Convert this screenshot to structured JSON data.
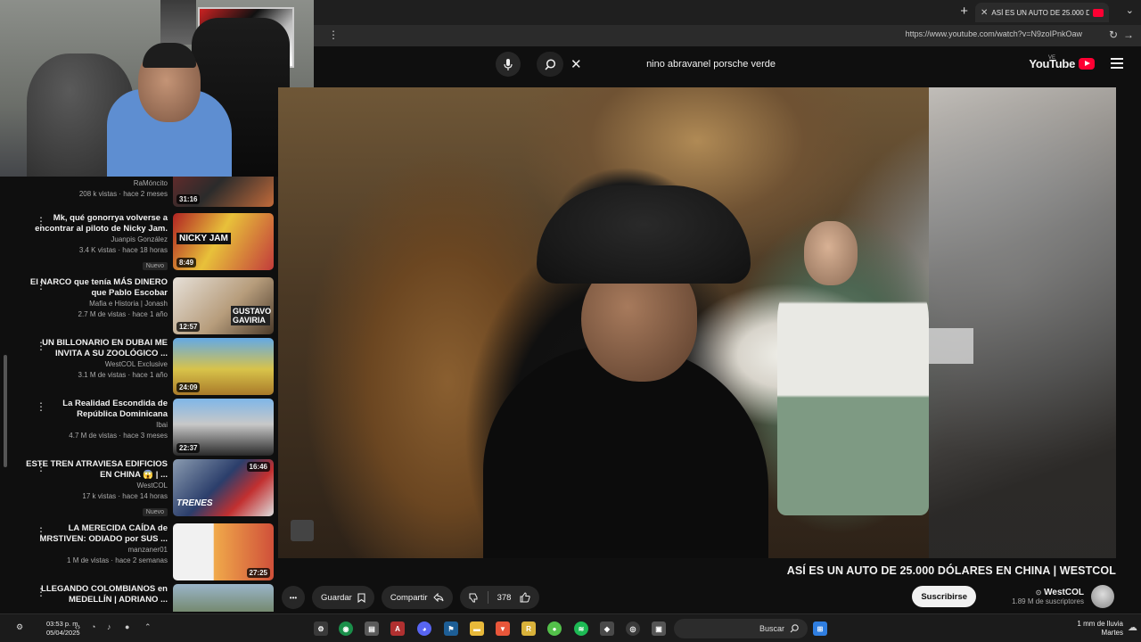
{
  "browser": {
    "tab_title": "ASÍ ES UN AUTO DE 25.000 D",
    "url": "https://www.youtube.com/watch?v=N9zoIPnkOaw",
    "new_tab": "+",
    "tab_close": "✕"
  },
  "youtube": {
    "logo_text": "YouTube",
    "logo_badge": "VE",
    "search_query": "nino abravanel porsche verde",
    "clear_symbol": "✕"
  },
  "video": {
    "title": "ASÍ ES UN AUTO DE 25.000 DÓLARES EN CHINA | WESTCOL",
    "channel_name": "WestCOL",
    "verified": "⊙",
    "subscribers": "1.89 M de suscriptores",
    "subscribe_label": "Suscribirse",
    "likes": "378",
    "share_label": "Compartir",
    "save_label": "Guardar",
    "more_label": "•••"
  },
  "sidebar": {
    "top_partial": {
      "channel": "RaMóncito",
      "views": "208 k vistas · hace 2 meses",
      "duration": "31:16"
    },
    "items": [
      {
        "title": "Mk, qué gonorrya volverse a encontrar al piloto de Nicky Jam.",
        "channel": "Juanpis González",
        "views": "3.4 K vistas · hace 18 horas",
        "badge": "Nuevo",
        "duration": "8:49",
        "thumb_text": "NICKY JAM"
      },
      {
        "title": "El NARCO que tenía MÁS DINERO que Pablo Escobar",
        "channel": "Mafia e Historia | Jonash",
        "views": "2.7 M de vistas · hace 1 año",
        "badge": "",
        "duration": "12:57",
        "thumb_text": "GUSTAVO GAVIRIA"
      },
      {
        "title": "UN BILLONARIO EN DUBAI ME INVITA A SU ZOOLÓGICO ...",
        "channel": "WestCOL Exclusive",
        "views": "3.1 M de vistas · hace 1 año",
        "badge": "",
        "duration": "24:09",
        "thumb_text": ""
      },
      {
        "title": "La Realidad Escondida de República Dominicana",
        "channel": "Ibai",
        "views": "4.7 M de vistas · hace 3 meses",
        "badge": "",
        "duration": "22:37",
        "thumb_text": ""
      },
      {
        "title": "ESTE TREN ATRAVIESA EDIFICIOS EN CHINA 😱 | ...",
        "channel": "WestCOL",
        "views": "17 k vistas · hace 14 horas",
        "badge": "Nuevo",
        "duration": "16:46",
        "thumb_text": "TRENES"
      },
      {
        "title": "LA MERECIDA CAÍDA de MRSTIVEN: ODIADO por SUS ...",
        "channel": "manzaner01",
        "views": "1 M de vistas · hace 2 semanas",
        "badge": "",
        "duration": "27:25",
        "thumb_text": ""
      },
      {
        "title": "LLEGANDO COLOMBIANOS en MEDELLÍN | ADRIANO ...",
        "channel": "",
        "views": "",
        "badge": "",
        "duration": "",
        "thumb_text": ""
      }
    ]
  },
  "taskbar": {
    "search_label": "Buscar",
    "time": "03:53 p. m.",
    "date": "05/04/2025",
    "weather_line1": "1 mm de lluvia",
    "weather_line2": "Martes"
  },
  "colors": {
    "youtube_red": "#ff0033",
    "background": "#0f0f0f",
    "pill": "#272727"
  }
}
